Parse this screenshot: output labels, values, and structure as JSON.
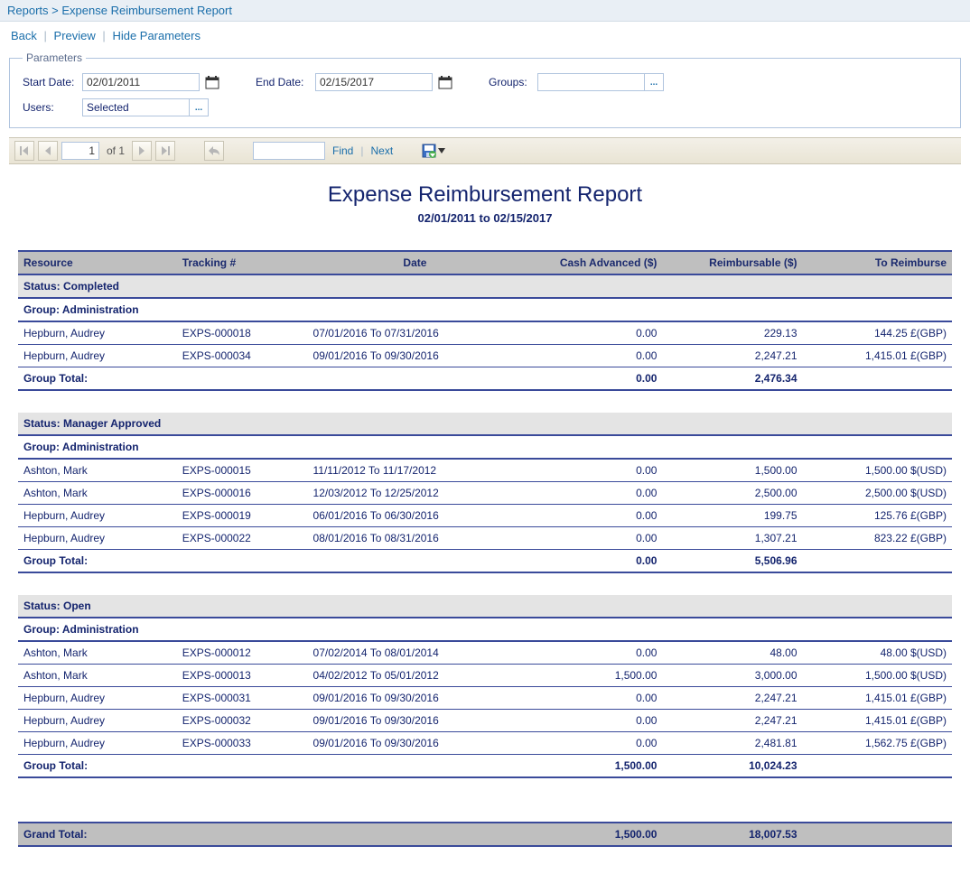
{
  "breadcrumb": {
    "root": "Reports",
    "sep": ">",
    "page": "Expense Reimbursement Report"
  },
  "links": {
    "back": "Back",
    "preview": "Preview",
    "hide": "Hide Parameters"
  },
  "params": {
    "legend": "Parameters",
    "start_label": "Start Date:",
    "start_value": "02/01/2011",
    "end_label": "End Date:",
    "end_value": "02/15/2017",
    "groups_label": "Groups:",
    "groups_value": "",
    "users_label": "Users:",
    "users_value": "Selected"
  },
  "viewer": {
    "page_value": "1",
    "of_label": "of 1",
    "find_label": "Find",
    "next_label": "Next",
    "search_value": ""
  },
  "report": {
    "title": "Expense Reimbursement Report",
    "subtitle": "02/01/2011 to 02/15/2017",
    "columns": {
      "resource": "Resource",
      "tracking": "Tracking #",
      "date": "Date",
      "cash": "Cash Advanced ($)",
      "reimb": "Reimbursable ($)",
      "toreimb": "To Reimburse"
    },
    "group_total_label": "Group Total:",
    "grand_total_label": "Grand Total:",
    "sections": [
      {
        "status": "Status: Completed",
        "group": "Group: Administration",
        "rows": [
          {
            "resource": "Hepburn, Audrey",
            "tracking": "EXPS-000018",
            "date": "07/01/2016 To 07/31/2016",
            "cash": "0.00",
            "reimb": "229.13",
            "toreimb": "144.25 £(GBP)"
          },
          {
            "resource": "Hepburn, Audrey",
            "tracking": "EXPS-000034",
            "date": "09/01/2016 To 09/30/2016",
            "cash": "0.00",
            "reimb": "2,247.21",
            "toreimb": "1,415.01 £(GBP)"
          }
        ],
        "total": {
          "cash": "0.00",
          "reimb": "2,476.34",
          "toreimb": ""
        }
      },
      {
        "status": "Status: Manager Approved",
        "group": "Group: Administration",
        "rows": [
          {
            "resource": "Ashton, Mark",
            "tracking": "EXPS-000015",
            "date": "11/11/2012 To 11/17/2012",
            "cash": "0.00",
            "reimb": "1,500.00",
            "toreimb": "1,500.00 $(USD)"
          },
          {
            "resource": "Ashton, Mark",
            "tracking": "EXPS-000016",
            "date": "12/03/2012 To 12/25/2012",
            "cash": "0.00",
            "reimb": "2,500.00",
            "toreimb": "2,500.00 $(USD)"
          },
          {
            "resource": "Hepburn, Audrey",
            "tracking": "EXPS-000019",
            "date": "06/01/2016 To 06/30/2016",
            "cash": "0.00",
            "reimb": "199.75",
            "toreimb": "125.76 £(GBP)"
          },
          {
            "resource": "Hepburn, Audrey",
            "tracking": "EXPS-000022",
            "date": "08/01/2016 To 08/31/2016",
            "cash": "0.00",
            "reimb": "1,307.21",
            "toreimb": "823.22 £(GBP)"
          }
        ],
        "total": {
          "cash": "0.00",
          "reimb": "5,506.96",
          "toreimb": ""
        }
      },
      {
        "status": "Status: Open",
        "group": "Group: Administration",
        "rows": [
          {
            "resource": "Ashton, Mark",
            "tracking": "EXPS-000012",
            "date": "07/02/2014 To 08/01/2014",
            "cash": "0.00",
            "reimb": "48.00",
            "toreimb": "48.00 $(USD)"
          },
          {
            "resource": "Ashton, Mark",
            "tracking": "EXPS-000013",
            "date": "04/02/2012 To 05/01/2012",
            "cash": "1,500.00",
            "reimb": "3,000.00",
            "toreimb": "1,500.00 $(USD)"
          },
          {
            "resource": "Hepburn, Audrey",
            "tracking": "EXPS-000031",
            "date": "09/01/2016 To 09/30/2016",
            "cash": "0.00",
            "reimb": "2,247.21",
            "toreimb": "1,415.01 £(GBP)"
          },
          {
            "resource": "Hepburn, Audrey",
            "tracking": "EXPS-000032",
            "date": "09/01/2016 To 09/30/2016",
            "cash": "0.00",
            "reimb": "2,247.21",
            "toreimb": "1,415.01 £(GBP)"
          },
          {
            "resource": "Hepburn, Audrey",
            "tracking": "EXPS-000033",
            "date": "09/01/2016 To 09/30/2016",
            "cash": "0.00",
            "reimb": "2,481.81",
            "toreimb": "1,562.75 £(GBP)"
          }
        ],
        "total": {
          "cash": "1,500.00",
          "reimb": "10,024.23",
          "toreimb": ""
        }
      }
    ],
    "grand_total": {
      "cash": "1,500.00",
      "reimb": "18,007.53",
      "toreimb": ""
    }
  }
}
